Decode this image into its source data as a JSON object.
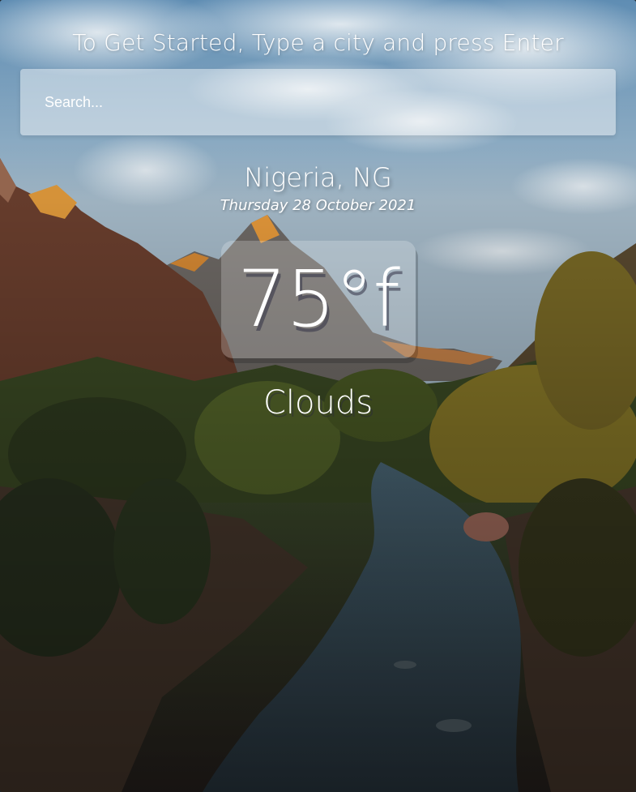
{
  "app": {
    "heading": "To Get Started, Type a city and press Enter"
  },
  "search": {
    "placeholder": "Search...",
    "value": ""
  },
  "weather": {
    "location": "Nigeria, NG",
    "date": "Thursday 28 October 2021",
    "temperature": "75°f",
    "condition": "Clouds"
  },
  "colors": {
    "text": "#ffffff",
    "search_box": "rgba(255,255,255,0.45)",
    "temp_box": "rgba(255,255,255,0.22)"
  }
}
